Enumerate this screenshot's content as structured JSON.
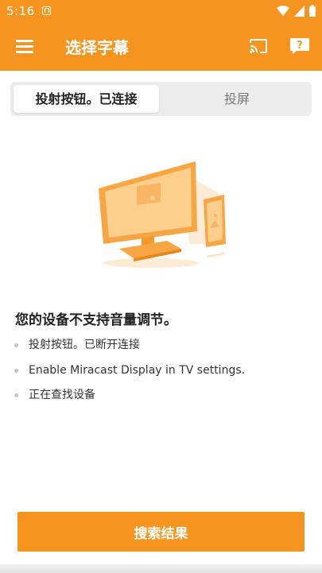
{
  "status_bar": {
    "time": "5:16"
  },
  "app_bar": {
    "title": "选择字幕"
  },
  "tabs": [
    {
      "label": "投射按钮。已连接"
    },
    {
      "label": "投屏"
    }
  ],
  "message": {
    "title": "您的设备不支持音量调节。",
    "items": [
      {
        "text": "投射按钮。已断开连接"
      },
      {
        "text": "Enable Miracast Display in TV settings."
      },
      {
        "text": "正在查找设备"
      }
    ]
  },
  "search_button": {
    "label": "搜索结果"
  },
  "colors": {
    "accent": "#F5951F"
  }
}
